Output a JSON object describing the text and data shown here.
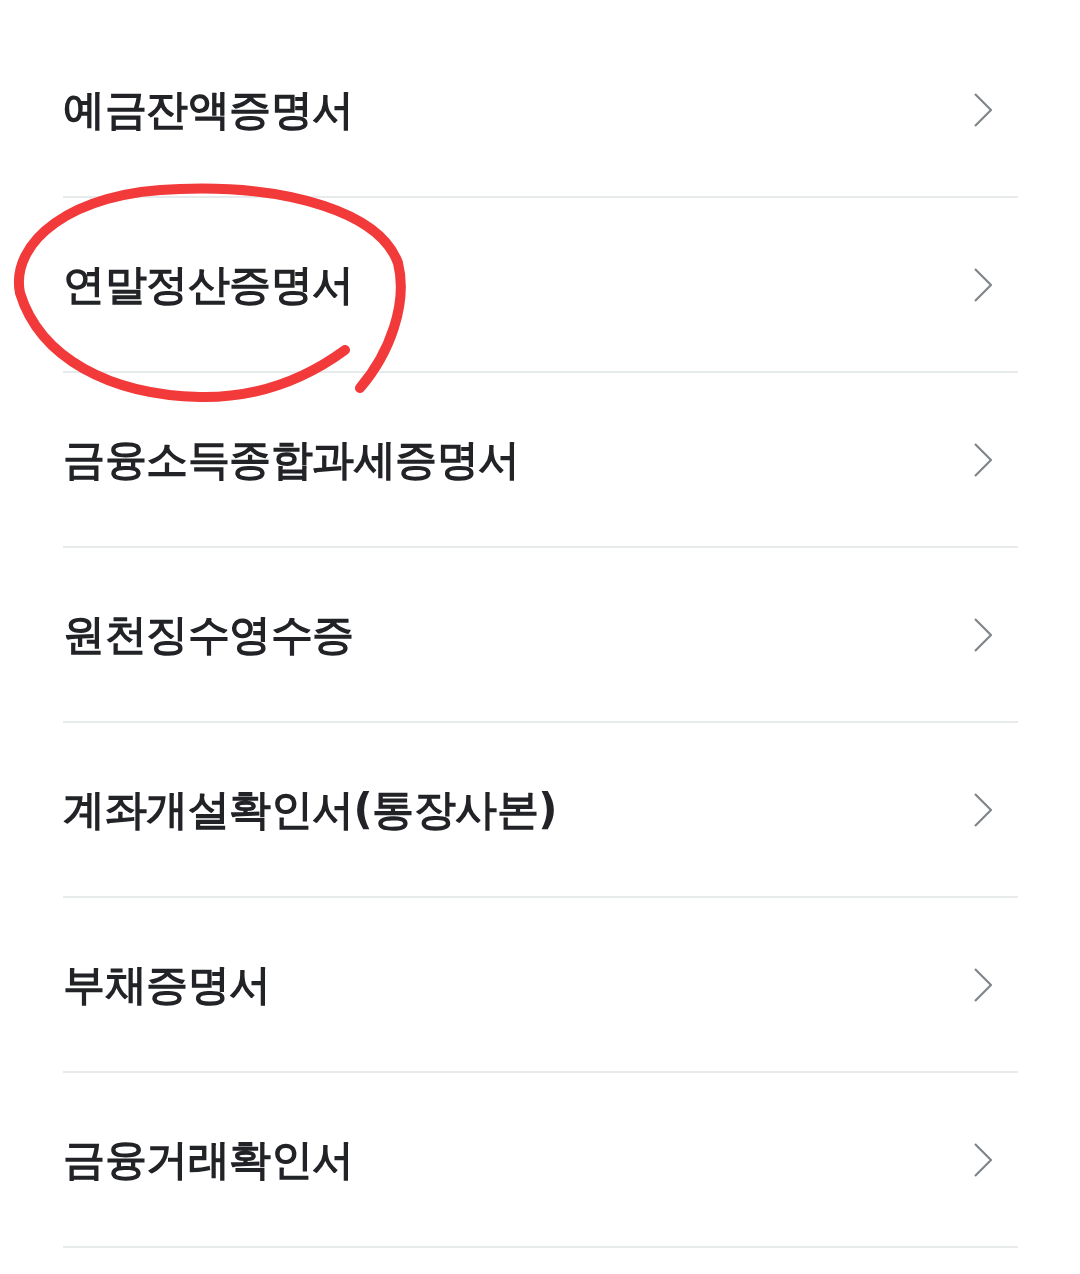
{
  "items": [
    {
      "label": "예금잔액증명서",
      "circled": false
    },
    {
      "label": "연말정산증명서",
      "circled": true
    },
    {
      "label": "금융소득종합과세증명서",
      "circled": false
    },
    {
      "label": "원천징수영수증",
      "circled": false
    },
    {
      "label": "계좌개설확인서(통장사본)",
      "circled": false
    },
    {
      "label": "부채증명서",
      "circled": false
    },
    {
      "label": "금융거래확인서",
      "circled": false
    }
  ]
}
